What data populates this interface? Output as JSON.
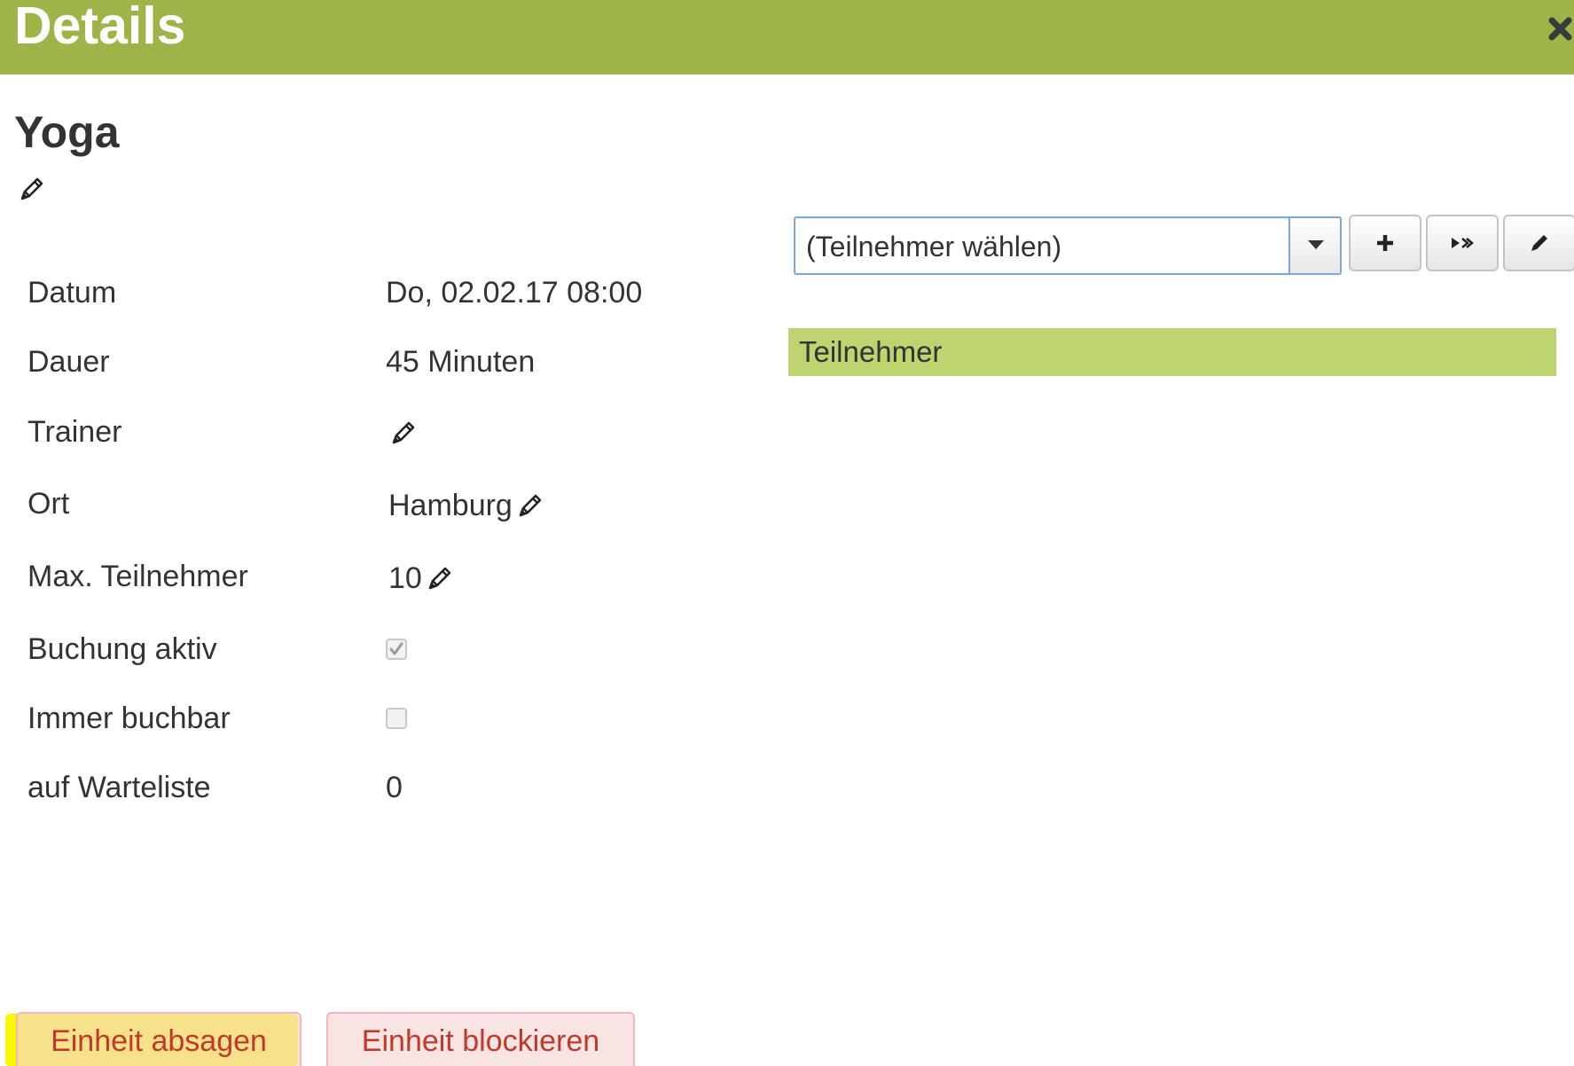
{
  "dialog": {
    "title": "Details",
    "close_icon": "close-icon"
  },
  "event": {
    "title": "Yoga",
    "title_edit_icon": "pencil-icon"
  },
  "details": {
    "datum": {
      "label": "Datum",
      "value": "Do, 02.02.17 08:00"
    },
    "dauer": {
      "label": "Dauer",
      "value": "45 Minuten"
    },
    "trainer": {
      "label": "Trainer",
      "value": ""
    },
    "ort": {
      "label": "Ort",
      "value": "Hamburg"
    },
    "max_teilnehmer": {
      "label": "Max. Teilnehmer",
      "value": "10"
    },
    "buchung_aktiv": {
      "label": "Buchung aktiv",
      "checked": true,
      "disabled": true
    },
    "immer_buchbar": {
      "label": "Immer buchbar",
      "checked": false,
      "disabled": true
    },
    "warteliste": {
      "label": "auf Warteliste",
      "value": "0"
    }
  },
  "participants": {
    "select_value": "(Teilnehmer wählen)",
    "buttons": [
      "plus-icon",
      "move-right-icon",
      "pencil-icon"
    ],
    "section_title": "Teilnehmer"
  },
  "actions": {
    "cancel_label": "Einheit absagen",
    "block_label": "Einheit blockieren"
  },
  "colors": {
    "header": "#9db548",
    "section_bar": "#bdd46f",
    "danger_text": "#c0392b",
    "highlight": "#f8f800"
  }
}
